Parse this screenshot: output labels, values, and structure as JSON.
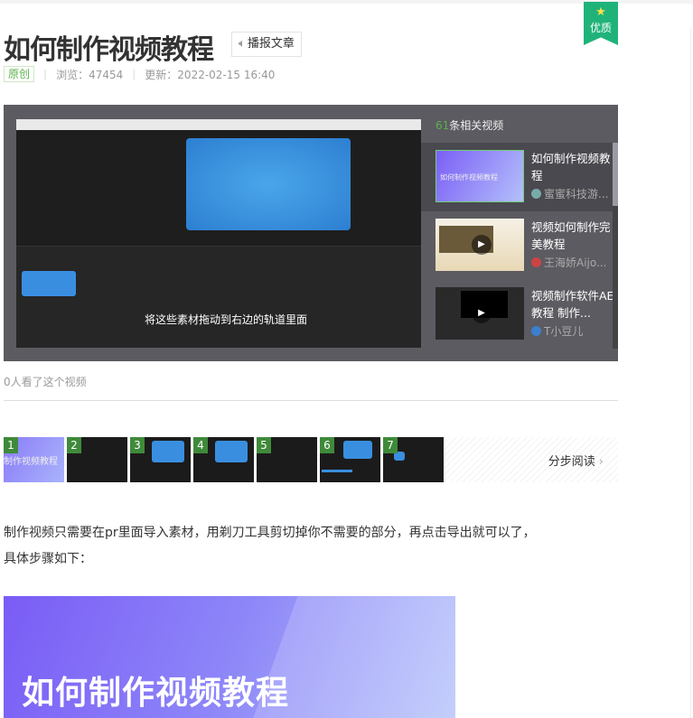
{
  "article": {
    "title": "如何制作视频教程",
    "speak_label": "播报文章",
    "badge": "优质",
    "original": "原创",
    "views": "浏览：47454",
    "updated": "更新：2022-02-15 16:40"
  },
  "video": {
    "subtitle": "将这些素材拖动到右边的轨道里面",
    "related_count": "61",
    "related_label": "条相关视频",
    "viewers": "0人看了这个视频",
    "items": [
      {
        "title": "如何制作视频教程",
        "author": "蜜蜜科技游...",
        "thumb_text": "如何制作视频教程"
      },
      {
        "title": "视频如何制作完美教程",
        "author": "王海娇Aijo..."
      },
      {
        "title": "视频制作软件AE教程 制作...",
        "author": "T小豆儿"
      }
    ]
  },
  "steps": {
    "numbers": [
      "1",
      "2",
      "3",
      "4",
      "5",
      "6",
      "7"
    ],
    "step1_text": "制作视频教程",
    "read_label": "分步阅读"
  },
  "body": {
    "paragraph": "制作视频只需要在pr里面导入素材，用剃刀工具剪切掉你不需要的部分，再点击导出就可以了，具体步骤如下：",
    "banner_text": "如何制作视频教程"
  }
}
